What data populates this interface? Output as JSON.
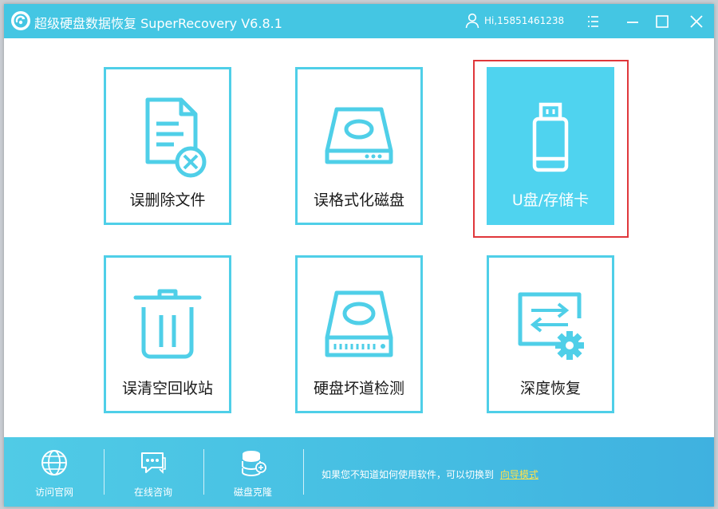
{
  "app": {
    "title": "超级硬盘数据恢复 SuperRecovery V6.8.1",
    "user": "Hi,15851461238"
  },
  "colors": {
    "accent": "#44c6e3",
    "tile_border": "#4fcfe8",
    "tile_active": "#4fd3ef",
    "highlight": "#e0373b",
    "link": "#ffe14a"
  },
  "tiles": [
    {
      "label": "误删除文件",
      "icon": "deleted-file-icon"
    },
    {
      "label": "误格式化磁盘",
      "icon": "disk-drive-icon"
    },
    {
      "label": "U盘/存储卡",
      "icon": "usb-drive-icon",
      "selected": true
    },
    {
      "label": "误清空回收站",
      "icon": "trash-bin-icon"
    },
    {
      "label": "硬盘坏道检测",
      "icon": "hard-disk-check-icon"
    },
    {
      "label": "深度恢复",
      "icon": "deep-recovery-icon"
    }
  ],
  "footer": {
    "items": [
      {
        "label": "访问官网",
        "icon": "globe-icon"
      },
      {
        "label": "在线咨询",
        "icon": "chat-icon"
      },
      {
        "label": "磁盘克隆",
        "icon": "disk-clone-icon"
      }
    ],
    "hint": "如果您不知道如何使用软件，可以切换到",
    "wizard_link": "向导模式"
  }
}
